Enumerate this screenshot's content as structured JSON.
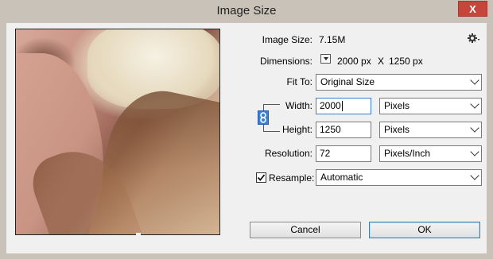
{
  "window": {
    "title": "Image Size",
    "close_label": "X"
  },
  "info": {
    "image_size_label": "Image Size:",
    "image_size_value": "7.15M",
    "dimensions_label": "Dimensions:",
    "dimensions_width": "2000 px",
    "dimensions_sep": "X",
    "dimensions_height": "1250 px"
  },
  "fit_to": {
    "label": "Fit To:",
    "value": "Original Size"
  },
  "width": {
    "label": "Width:",
    "value": "2000",
    "unit": "Pixels"
  },
  "height": {
    "label": "Height:",
    "value": "1250",
    "unit": "Pixels"
  },
  "resolution": {
    "label": "Resolution:",
    "value": "72",
    "unit": "Pixels/Inch"
  },
  "resample": {
    "label": "Resample:",
    "value": "Automatic",
    "checked": true
  },
  "buttons": {
    "cancel": "Cancel",
    "ok": "OK"
  },
  "icons": {
    "settings": "gear-icon",
    "constrain": "chain-link-icon",
    "checkbox": "checkmark-icon"
  }
}
